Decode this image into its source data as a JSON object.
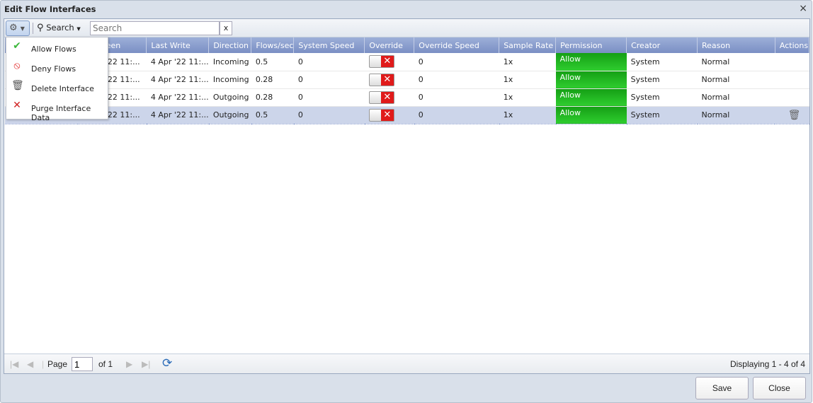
{
  "window": {
    "title": "Edit Flow Interfaces",
    "close": "×"
  },
  "toolbar": {
    "gear": "⚙",
    "search_label": "Search",
    "search_placeholder": "Search",
    "search_clear": "x"
  },
  "menu": [
    {
      "icon": "check-icon",
      "glyph": "✔",
      "color": "#3cb83c",
      "label": "Allow Flows"
    },
    {
      "icon": "deny-icon",
      "glyph": "⦸",
      "color": "#e02020",
      "label": "Deny Flows"
    },
    {
      "icon": "trash-icon",
      "glyph": "🗑",
      "color": "#555",
      "label": "Delete Interface"
    },
    {
      "icon": "x-icon",
      "glyph": "✕",
      "color": "#d02020",
      "label": "Purge Interface Data"
    }
  ],
  "columns": [
    "",
    "Last Seen",
    "Last Write",
    "Direction",
    "Flows/sec",
    "System Speed",
    "Override",
    "Override Speed",
    "Sample Rate",
    "Permission",
    "Creator",
    "Reason",
    "Actions"
  ],
  "rows": [
    {
      "last_seen": "4 Apr '22 11:...",
      "last_write": "4 Apr '22 11:...",
      "direction": "Incoming",
      "flows": "0.5",
      "system_speed": "0",
      "override_speed": "0",
      "sample_rate": "1x",
      "permission": "Allow",
      "creator": "System",
      "reason": "Normal"
    },
    {
      "last_seen": "4 Apr '22 11:...",
      "last_write": "4 Apr '22 11:...",
      "direction": "Incoming",
      "flows": "0.28",
      "system_speed": "0",
      "override_speed": "0",
      "sample_rate": "1x",
      "permission": "Allow",
      "creator": "System",
      "reason": "Normal"
    },
    {
      "last_seen": "4 Apr '22 11:...",
      "last_write": "4 Apr '22 11:...",
      "direction": "Outgoing",
      "flows": "0.28",
      "system_speed": "0",
      "override_speed": "0",
      "sample_rate": "1x",
      "permission": "Allow",
      "creator": "System",
      "reason": "Normal"
    },
    {
      "last_seen": "4 Apr '22 11:...",
      "last_write": "4 Apr '22 11:...",
      "direction": "Outgoing",
      "flows": "0.5",
      "system_speed": "0",
      "override_speed": "0",
      "sample_rate": "1x",
      "permission": "Allow",
      "creator": "System",
      "reason": "Normal",
      "selected": true
    }
  ],
  "colors": {
    "permission_allow": "#22b822",
    "override_off": "#e01a1a",
    "header": "#8a9ccf"
  },
  "pager": {
    "page_label": "Page",
    "page": "1",
    "of": "of 1",
    "display": "Displaying 1 - 4 of 4"
  },
  "buttons": {
    "save": "Save",
    "close": "Close"
  }
}
